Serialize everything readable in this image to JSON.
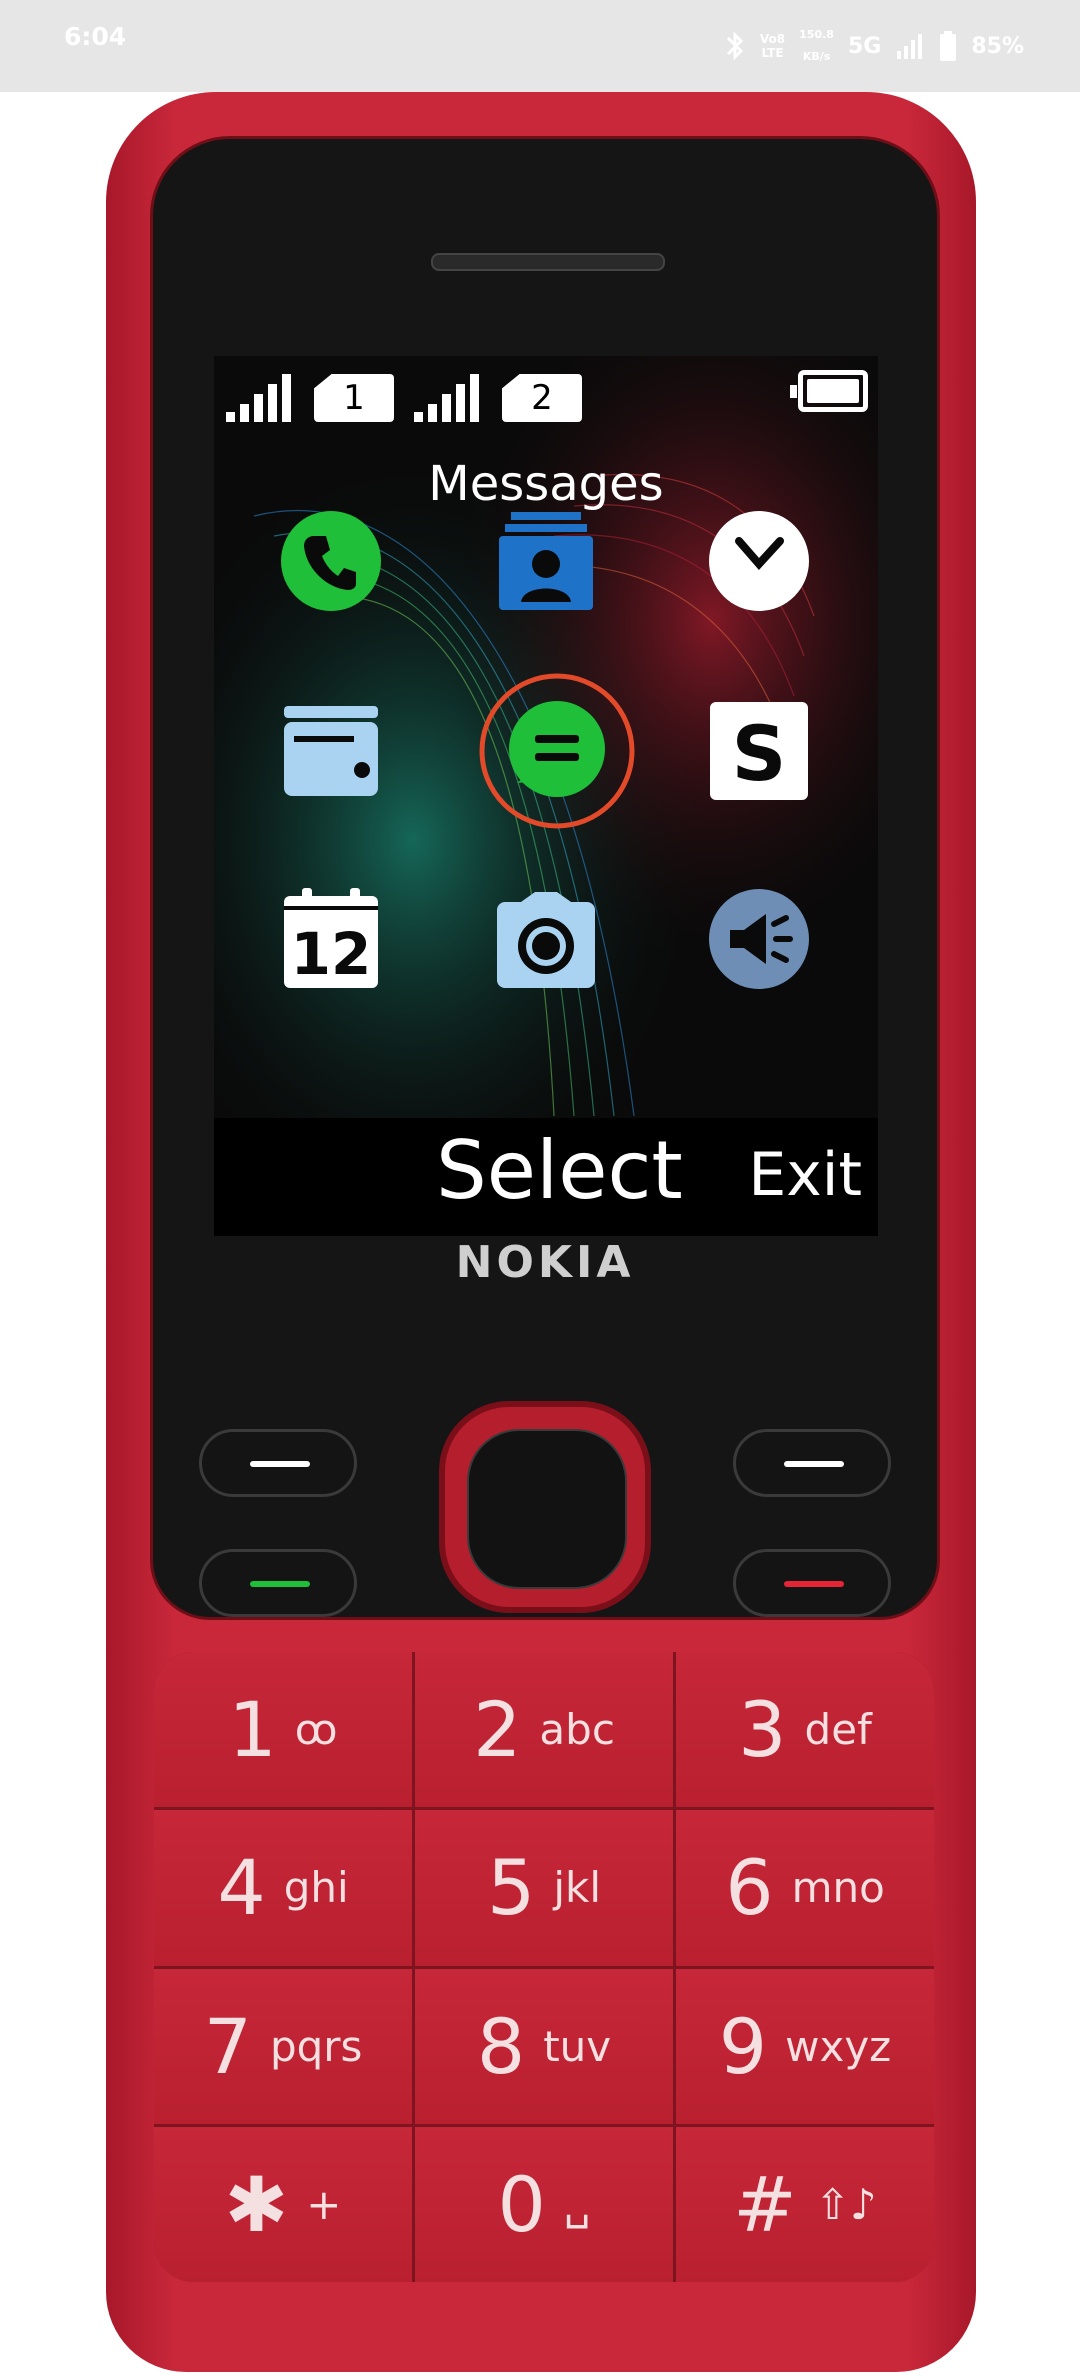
{
  "status_bar": {
    "time": "6:04",
    "volte_label": "Vo8",
    "lte_label": "LTE",
    "speed_value": "150.8",
    "speed_unit": "KB/s",
    "network": "5G",
    "battery": "85%"
  },
  "phone": {
    "screen_title": "Messages",
    "sim1_label": "1",
    "sim2_label": "2",
    "softkey_select": "Select",
    "softkey_exit": "Exit",
    "brand": "NOKIA",
    "calendar_day": "12",
    "apps": [
      {
        "icon": "phone-icon"
      },
      {
        "icon": "contacts-icon"
      },
      {
        "icon": "clock-icon"
      },
      {
        "icon": "wallet-icon"
      },
      {
        "icon": "messages-icon"
      },
      {
        "icon": "skype-icon"
      },
      {
        "icon": "calendar-icon"
      },
      {
        "icon": "camera-icon"
      },
      {
        "icon": "radio-icon"
      }
    ],
    "keys": [
      {
        "num": "1",
        "letters": "ꝏ"
      },
      {
        "num": "2",
        "letters": "abc"
      },
      {
        "num": "3",
        "letters": "def"
      },
      {
        "num": "4",
        "letters": "ghi"
      },
      {
        "num": "5",
        "letters": "jkl"
      },
      {
        "num": "6",
        "letters": "mno"
      },
      {
        "num": "7",
        "letters": "pqrs"
      },
      {
        "num": "8",
        "letters": "tuv"
      },
      {
        "num": "9",
        "letters": "wxyz"
      },
      {
        "num": "✱",
        "letters": "+"
      },
      {
        "num": "0",
        "letters": "␣"
      },
      {
        "num": "#",
        "letters": "⇧♪"
      }
    ],
    "colors": {
      "body": "#c9283a",
      "accent_green": "#1fbf3a",
      "accent_red": "#e52535",
      "focus_ring": "#e24a2a"
    }
  }
}
